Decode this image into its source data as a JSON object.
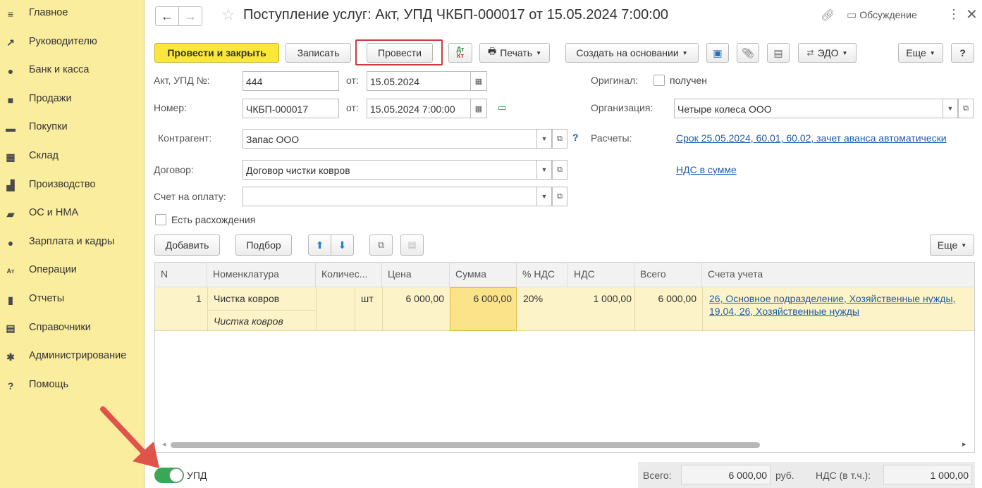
{
  "sidebar": {
    "items": [
      {
        "label": "Главное",
        "icon": "≡"
      },
      {
        "label": "Руководителю",
        "icon": "↗"
      },
      {
        "label": "Банк и касса",
        "icon": "●"
      },
      {
        "label": "Продажи",
        "icon": "■"
      },
      {
        "label": "Покупки",
        "icon": "▬"
      },
      {
        "label": "Склад",
        "icon": "▦"
      },
      {
        "label": "Производство",
        "icon": "▟"
      },
      {
        "label": "ОС и НМА",
        "icon": "▰"
      },
      {
        "label": "Зарплата и кадры",
        "icon": "●"
      },
      {
        "label": "Операции",
        "icon": "Aт"
      },
      {
        "label": "Отчеты",
        "icon": "▮"
      },
      {
        "label": "Справочники",
        "icon": "▤"
      },
      {
        "label": "Администрирование",
        "icon": "✱"
      },
      {
        "label": "Помощь",
        "icon": "?"
      }
    ]
  },
  "header": {
    "title": "Поступление услуг: Акт, УПД ЧКБП-000017 от 15.05.2024 7:00:00",
    "discussion": "Обсуждение"
  },
  "toolbar": {
    "post_close": "Провести и закрыть",
    "save": "Записать",
    "post": "Провести",
    "dtkt": "Дт Кт",
    "print": "Печать",
    "create_based": "Создать на основании",
    "edo": "ЭДО",
    "more": "Еще",
    "help": "?"
  },
  "form": {
    "act_label": "Акт, УПД №:",
    "act_number": "444",
    "from_label": "от:",
    "act_date": "15.05.2024",
    "number_label": "Номер:",
    "number": "ЧКБП-000017",
    "number_date": "15.05.2024  7:00:00",
    "contractor_label": "Контрагент:",
    "contractor": "Запас ООО",
    "contract_label": "Договор:",
    "contract": "Договор чистки ковров",
    "invoice_label": "Счет на оплату:",
    "invoice": "",
    "discrepancy": "Есть расхождения",
    "original_label": "Оригинал:",
    "original_received": "получен",
    "org_label": "Организация:",
    "org": "Четыре колеса ООО",
    "payments_label": "Расчеты:",
    "payments_link": "Срок 25.05.2024, 60.01, 60.02, зачет аванса автоматически",
    "vat_link": "НДС в сумме"
  },
  "table_toolbar": {
    "add": "Добавить",
    "pick": "Подбор",
    "more": "Еще"
  },
  "table": {
    "columns": [
      "N",
      "Номенклатура",
      "Количес...",
      "Цена",
      "Сумма",
      "% НДС",
      "НДС",
      "Всего",
      "Счета учета"
    ],
    "rows": [
      {
        "n": "1",
        "item": "Чистка ковров",
        "item_sub": "Чистка ковров",
        "unit": "шт",
        "price": "6 000,00",
        "sum": "6 000,00",
        "vat_rate": "20%",
        "vat": "1 000,00",
        "total": "6 000,00",
        "accounts_line1": "26, Основное подразделение, Хозяйственные нужды,",
        "accounts_line2": "19.04, 26, Хозяйственные нужды"
      }
    ]
  },
  "footer": {
    "upd_label": "УПД",
    "total_label": "Всего:",
    "total": "6 000,00",
    "currency": "руб.",
    "vat_label": "НДС (в т.ч.):",
    "vat_total": "1 000,00"
  },
  "colors": {
    "sidebar_bg": "#fbed9e",
    "primary_button": "#fbe63c",
    "link": "#1f5da8",
    "selected_row": "#fdf3c8",
    "highlight_frame": "#d0393b",
    "toggle_on": "#3aa757",
    "arrow": "#e0534a"
  }
}
